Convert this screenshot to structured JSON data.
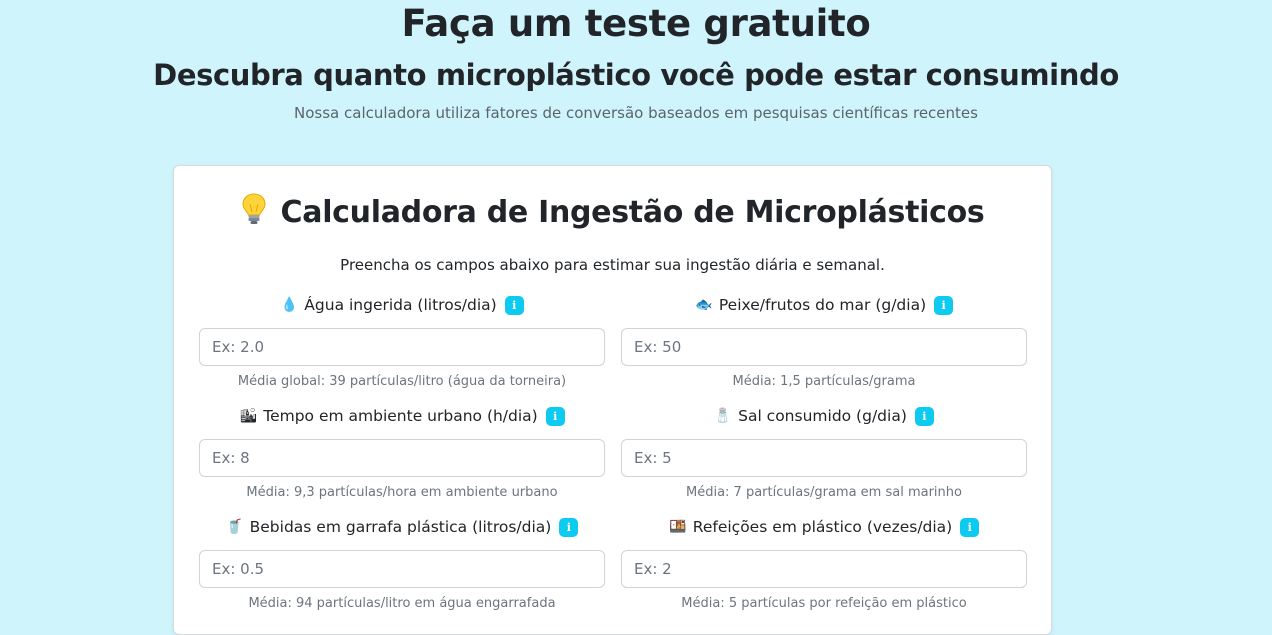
{
  "hero": {
    "title": "Faça um teste gratuito",
    "subtitle": "Descubra quanto microplástico você pode estar consumindo",
    "lead": "Nossa calculadora utiliza fatores de conversão baseados em pesquisas científicas recentes"
  },
  "calculator": {
    "title": "Calculadora de Ingestão de Microplásticos",
    "title_icon": "lightbulb-icon",
    "intro": "Preencha os campos abaixo para estimar sua ingestão diária e semanal.",
    "info_glyph": "i",
    "fields": [
      {
        "icon": "droplet-icon",
        "emoji": "💧",
        "label": "Água ingerida (litros/dia)",
        "placeholder": "Ex: 2.0",
        "value": "",
        "hint": "Média global: 39 partículas/litro (água da torneira)"
      },
      {
        "icon": "fish-icon",
        "emoji": "🐟",
        "label": "Peixe/frutos do mar (g/dia)",
        "placeholder": "Ex: 50",
        "value": "",
        "hint": "Média: 1,5 partículas/grama"
      },
      {
        "icon": "city-icon",
        "emoji": "🏙",
        "label": "Tempo em ambiente urbano (h/dia)",
        "placeholder": "Ex: 8",
        "value": "",
        "hint": "Média: 9,3 partículas/hora em ambiente urbano"
      },
      {
        "icon": "salt-shaker-icon",
        "emoji": "🧂",
        "label": "Sal consumido (g/dia)",
        "placeholder": "Ex: 5",
        "value": "",
        "hint": "Média: 7 partículas/grama em sal marinho"
      },
      {
        "icon": "cup-with-straw-icon",
        "emoji": "🥤",
        "label": "Bebidas em garrafa plástica (litros/dia)",
        "placeholder": "Ex: 0.5",
        "value": "",
        "hint": "Média: 94 partículas/litro em água engarrafada"
      },
      {
        "icon": "bento-box-icon",
        "emoji": "🍱",
        "label": "Refeições em plástico (vezes/dia)",
        "placeholder": "Ex: 2",
        "value": "",
        "hint": "Média: 5 partículas por refeição em plástico"
      }
    ]
  },
  "colors": {
    "background": "#cff4fc",
    "info_badge": "#0dcaf0",
    "card": "#ffffff",
    "muted_text": "#6c757d"
  }
}
